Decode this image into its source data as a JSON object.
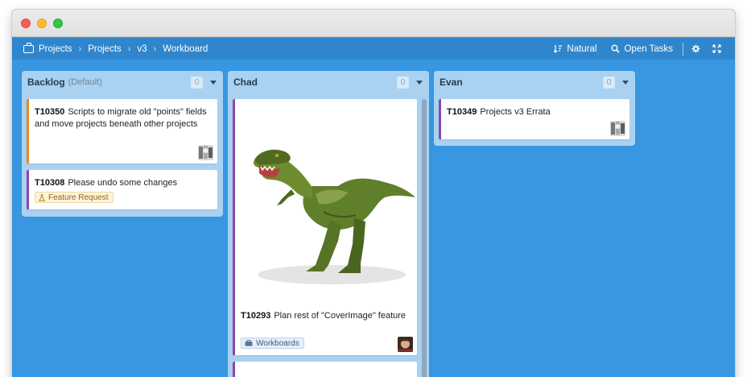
{
  "window": {
    "controls": [
      "close",
      "minimize",
      "zoom"
    ]
  },
  "nav": {
    "breadcrumbs": [
      "Projects",
      "Projects",
      "v3",
      "Workboard"
    ],
    "breadcrumb_icon": "briefcase-icon",
    "sort_label": "Natural",
    "filter_label": "Open Tasks",
    "tools": [
      "sort-icon",
      "search-icon",
      "gear-icon",
      "fullscreen-icon"
    ]
  },
  "colors": {
    "board_bg": "#3996e0",
    "nav_bg": "#2f86cc",
    "column_bg": "#a9d2f2",
    "orange": "#e48a1f",
    "purple": "#8e44ad"
  },
  "columns": [
    {
      "title": "Backlog",
      "subtitle": "(Default)",
      "count": "0",
      "cards": [
        {
          "id": "T10350",
          "title": "Scripts to migrate old \"points\" fields and move projects beneath other projects",
          "color": "orange"
        },
        {
          "id": "T10308",
          "title": "Please undo some changes",
          "color": "purple",
          "tag": "Feature Request"
        }
      ]
    },
    {
      "title": "Chad",
      "count": "0",
      "cards": [
        {
          "id": "T10293",
          "title": "Plan rest of \"CoverImage\" feature",
          "color": "purple",
          "tag": "Workboards",
          "cover": "t-rex-figurine"
        }
      ]
    },
    {
      "title": "Evan",
      "count": "0",
      "cards": [
        {
          "id": "T10349",
          "title": "Projects v3 Errata",
          "color": "purple"
        }
      ]
    }
  ]
}
